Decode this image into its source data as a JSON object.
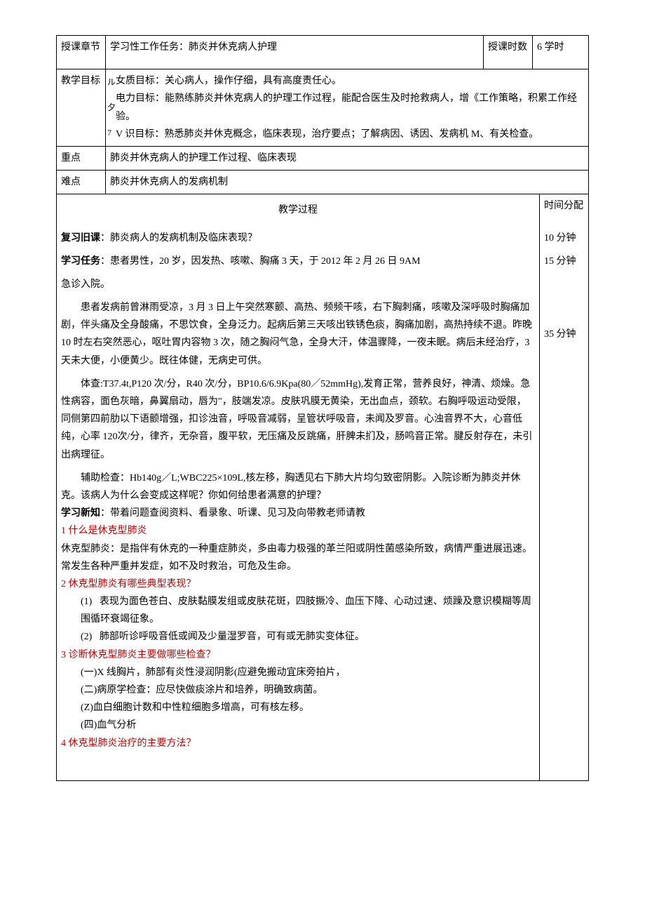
{
  "header": {
    "chapter_label": "授课章节",
    "chapter_value": "学习性工作任务：肺炎并休克病人护理",
    "hours_label": "授课时数",
    "hours_value": "6 学时"
  },
  "goals": {
    "label": "教学目标",
    "bracket_ru": "ル",
    "bracket_xi": "夕",
    "bracket_seven": "7",
    "line1": "女质目标：关心病人，操作仔细，具有高度责任心。",
    "line2": "电力目标：能熟练肺炎并休克病人的护理工作过程，能配合医生及时抢救病人，增《工作策略，积累工作经验。",
    "line3": "V 识目标：熟悉肺炎并休克概念，临床表现，治疗要点；了解病因、诱因、发病机 M、有关检查。"
  },
  "key": {
    "label": "重点",
    "value": "肺炎并休克病人的护理工作过程、临床表现"
  },
  "diff": {
    "label": "难点",
    "value": "肺炎并休克病人的发病机制"
  },
  "process": {
    "title": "教学过程",
    "time_label": "时间分配",
    "review_label": "复习旧课",
    "review_text": "：肺炎病人的发病机制及临床表现？",
    "review_time": "10 分钟",
    "task_label": "学习任务",
    "task_text_head": "：患者男性，20 岁，因发热、咳嗽、胸痛 3 天，于 2012 年 2 月 26 日 9AM",
    "task_text_tail": "急诊入院。",
    "task_time": "15 分钟",
    "p1": "患者发病前曾淋雨受凉，3 月 3 日上午突然寒颤、高热、频频干咳，右下胸刺痛，咳嗽及深呼吸时胸痛加剧，伴头痛及全身酸痛，不思饮食，全身泛力。起病后第三天咳出铁锈色痰，胸痛加剧，高热持续不退。昨晚 10 时左右突然恶心，呕吐胃内容物 3 次，随之胸闷气急，全身大汗，体温骤降，一夜未眠。病后未经治疗，3 天未大便，小便黄少。既往体健，无病史可供。",
    "p1_time": "35 分钟",
    "p2": "体查:T37.4t,P120 次/分，R40 次/分，BP10.6/6.9Kpa(80／52mmHg),发育正常，营养良好，神清、烦燥。急性病容，面色灰暗，鼻翼扇动，唇为\"，肢端发凉。皮肤巩膜无黄染，无出血点，颈软。右胸呼吸运动受限，同侧第四前肋以下语颤增强，扣诊浊音，呼吸音减弱，呈管状呼吸音，未闻及罗音。心浊音界不大，心音低纯，心率 120次/分，律齐，无杂音，腹平软，无压痛及反跳痛，肝脾未扪及，肠鸣音正常。腱反射存在，未引出病理征。",
    "p3": "辅助检查：Hb140g／L;WBC225×109L,核左移，胸透见右下肺大片均匀致密阴影。入院诊断为肺炎并休克。该病人为什么会变成这样呢？你如何给患者满意的护理？",
    "learn_label": "学习新知",
    "learn_text": "：带着问题查阅资料、看录象、听课、见习及向带教老师请教",
    "q1": "1 什么是休克型肺炎",
    "a1": "休克型肺炎：是指伴有休克的一种重症肺炎，多由毒力极强的革兰阳或阴性菌感染所致，病情严重进展迅速。常发生各种严重并发症，如不及时救治，可危及生命。",
    "q2": "2 休克型肺炎有哪些典型表现？",
    "a2_1_num": "(1)",
    "a2_1": "表现为面色苍白、皮肤黏膜发组或皮肤花斑，四肢撅冷、血压下降、心动过速、烦躁及意识模糊等周围循环衰竭征象。",
    "a2_2_num": "(2)",
    "a2_2": "肺部听诊呼吸音低或闻及少量湿罗音，可有或无肺实变体征。",
    "q3": "3 诊断休克型肺炎主要做哪些检查？",
    "a3_1": "(一)X 线胸片，肺部有炎性浸润阴影(应避免搬动宜床旁拍片，",
    "a3_2": "(二)病原学检查：应尽快做痰涂片和培养，明确致病菌。",
    "a3_3": "(Z)血白细胞计数和中性粒细胞多增高，可有核左移。",
    "a3_4": "(四)血气分析",
    "q4": "4 休克型肺炎治疗的主要方法？"
  }
}
